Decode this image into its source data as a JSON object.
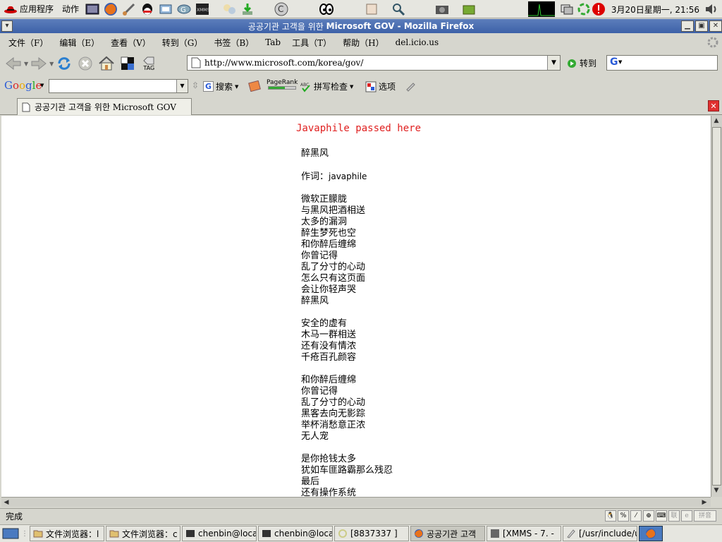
{
  "top_panel": {
    "menus": [
      "应用程序",
      "动作"
    ],
    "clock": "3月20日星期一, 21:56"
  },
  "window": {
    "title_korean": "공공기관 고객을 위한",
    "title_rest": "Microsoft GOV - Mozilla Firefox"
  },
  "menubar": {
    "items": [
      "文件（F）",
      "编辑（E）",
      "查看（V）",
      "转到（G）",
      "书签（B）",
      "Tab",
      "工具（T）",
      "帮助（H）",
      "del.icio.us"
    ]
  },
  "navbar": {
    "url": "http://www.microsoft.com/korea/gov/",
    "go_label": "转到",
    "tag_label": "TAG"
  },
  "google_toolbar": {
    "logo": "Google",
    "search_label": "搜索",
    "pagerank_label": "PageRank",
    "spellcheck_label": "拼写检查",
    "options_label": "选项"
  },
  "tab": {
    "label": "공공기관 고객을 위한 Microsoft GOV"
  },
  "content": {
    "heading": "Javaphile passed here",
    "title": "醉黑风",
    "credit_prefix": "作词：",
    "credit_name": "javaphile",
    "stanzas": [
      [
        "微软正朦胧",
        "与黑风把酒相送",
        "太多的漏洞",
        "醉生梦死也空",
        "和你醉后缠绵",
        "你曾记得",
        "乱了分寸的心动",
        "怎么只有这页面",
        "会让你轻声哭",
        "醉黑风"
      ],
      [
        "安全的虚有",
        "木马一群相送",
        "还有没有情浓",
        "千疮百孔颜容"
      ],
      [
        "和你醉后缠绵",
        "你曾记得",
        "乱了分寸的心动",
        "黑客去向无影踪",
        "举杯消愁意正浓",
        "无人宠"
      ],
      [
        "是你抢钱太多",
        "犹如车匪路霸那么残忍",
        "最后",
        "还有操作系统"
      ]
    ]
  },
  "statusbar": {
    "text": "完成",
    "ime_labels": [
      "联",
      "e",
      "拼音"
    ]
  },
  "taskbar": {
    "tasks": [
      "文件浏览器：l",
      "文件浏览器：c",
      "chenbin@local",
      "chenbin@local",
      "[8837337 ]",
      "공공기관 고객",
      "[XMMS - 7. -",
      "[/usr/include/u"
    ]
  }
}
